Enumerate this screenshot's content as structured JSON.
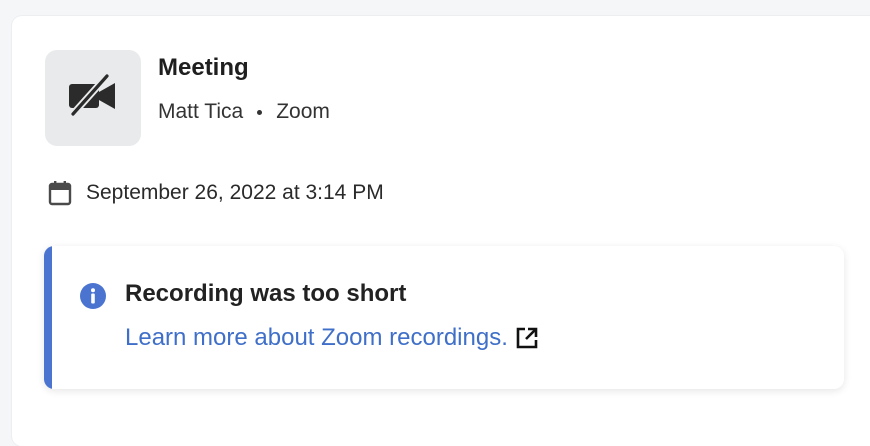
{
  "meeting": {
    "title": "Meeting",
    "host": "Matt Tica",
    "platform": "Zoom",
    "icon": "video-off-icon",
    "date": "September 26, 2022 at 3:14 PM"
  },
  "notice": {
    "accent_color": "#4a74d0",
    "headline": "Recording was too short",
    "link_text": "Learn more about Zoom recordings.",
    "link_color": "#3f6fc8"
  }
}
